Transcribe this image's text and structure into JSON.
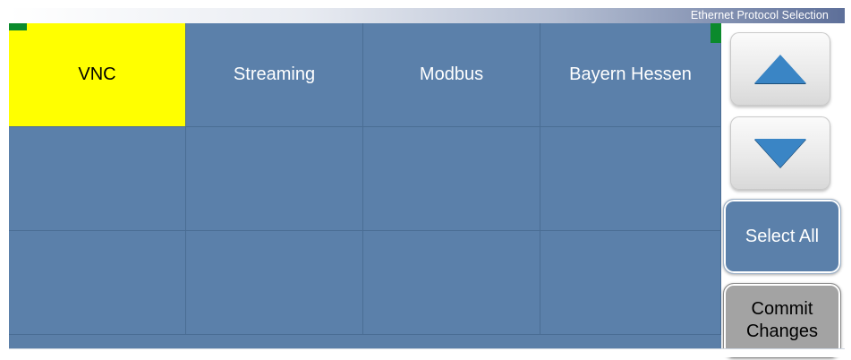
{
  "title": "Ethernet Protocol Selection",
  "grid": {
    "rows": [
      [
        {
          "label": "VNC",
          "selected": true
        },
        {
          "label": "Streaming",
          "selected": false
        },
        {
          "label": "Modbus",
          "selected": false
        },
        {
          "label": "Bayern Hessen",
          "selected": false
        }
      ],
      [
        {
          "label": "",
          "selected": false
        },
        {
          "label": "",
          "selected": false
        },
        {
          "label": "",
          "selected": false
        },
        {
          "label": "",
          "selected": false
        }
      ],
      [
        {
          "label": "",
          "selected": false
        },
        {
          "label": "",
          "selected": false
        },
        {
          "label": "",
          "selected": false
        },
        {
          "label": "",
          "selected": false
        }
      ]
    ]
  },
  "side": {
    "scroll_up_icon": "triangle-up-icon",
    "scroll_down_icon": "triangle-down-icon",
    "select_all": "Select All",
    "commit_line1": "Commit",
    "commit_line2": "Changes"
  },
  "colors": {
    "cell": "#5b80aa",
    "selected": "#ffff00",
    "arrow": "#3a85c5",
    "commit": "#a3a3a3",
    "marker": "#0b8a2c"
  }
}
